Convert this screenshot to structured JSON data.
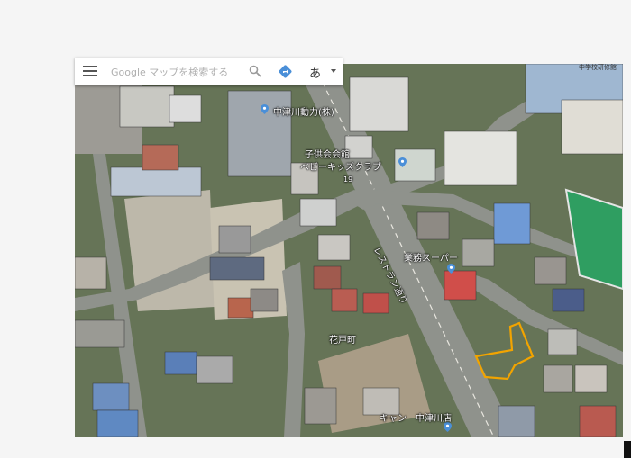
{
  "search": {
    "placeholder": "Google マップを検索する",
    "language_label": "あ"
  },
  "icons": {
    "menu": "hamburger-menu-icon",
    "search": "magnifier-icon",
    "directions": "directions-diamond-icon",
    "place": "map-pin-icon"
  },
  "labels": {
    "nakatsugawa_power": "中津川動力(株)",
    "childrens_hall": "子供会会館",
    "baby_kids_club": "ベビーキッズクラブ",
    "route_number": "19",
    "restaurant_street": "レストラン通り",
    "gyomu_super": "業務スーパー",
    "hanato": "花戸町",
    "store": "キャン　中津川店",
    "top_right_name": "中学校研修館"
  },
  "colors": {
    "highlight_outline": "#f2a400",
    "pin": "#4a8fd8",
    "road": "#8f928c",
    "vegetation": "#5e7046"
  }
}
